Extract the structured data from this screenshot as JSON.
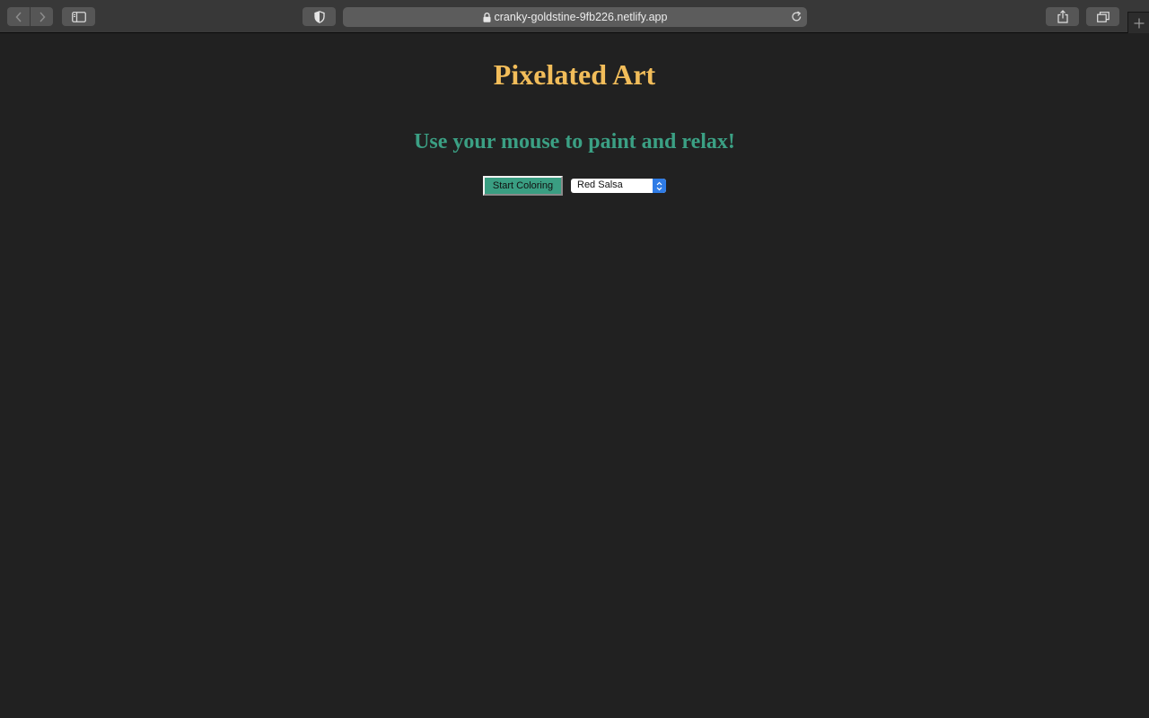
{
  "browser": {
    "url": "cranky-goldstine-9fb226.netlify.app",
    "icons": {
      "back": "chevron-left-icon",
      "forward": "chevron-right-icon",
      "sidebar": "sidebar-icon",
      "privacy": "shield-icon",
      "lock": "lock-icon",
      "reload": "reload-icon",
      "share": "share-icon",
      "tabs": "tabs-overview-icon",
      "new_tab": "plus-icon"
    }
  },
  "page": {
    "title": "Pixelated Art",
    "subtitle": "Use your mouse to paint and relax!",
    "start_button_label": "Start Coloring",
    "color_select": {
      "selected": "Red Salsa"
    }
  },
  "colors": {
    "background": "#212121",
    "title": "#f2bd5a",
    "subtitle": "#3ba084",
    "button": "#3a9e82",
    "select_accent": "#2f7ce6"
  }
}
